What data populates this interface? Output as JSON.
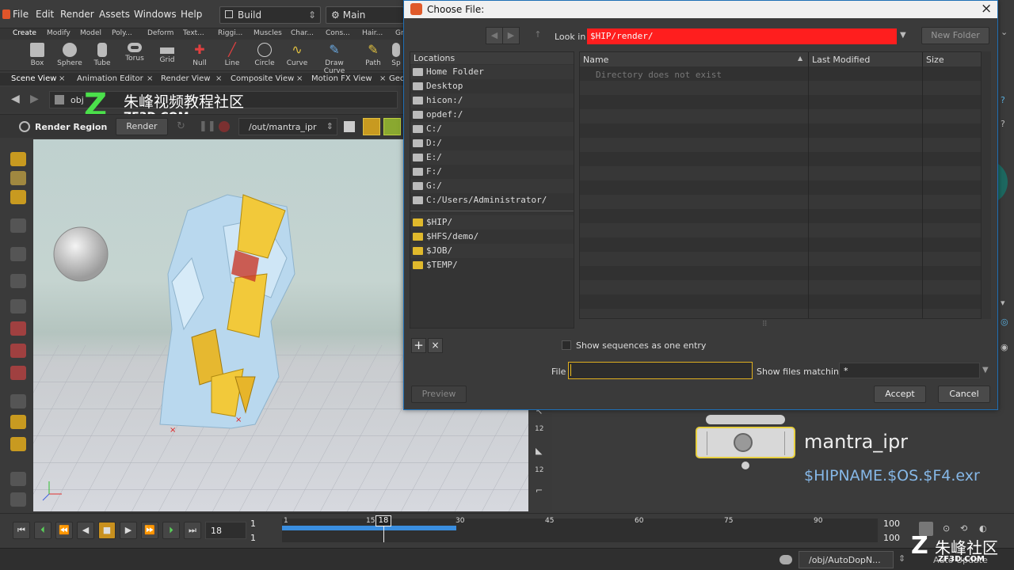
{
  "menubar": {
    "items": [
      "File",
      "Edit",
      "Render",
      "Assets",
      "Windows",
      "Help"
    ],
    "desktop_label": "Build",
    "context_label": "Main"
  },
  "shelf": {
    "tabs": [
      "Create",
      "Modify",
      "Model",
      "Poly...",
      "Deform",
      "Text...",
      "Riggi...",
      "Muscles",
      "Char...",
      "Cons...",
      "Hair...",
      "Gr"
    ],
    "tools": [
      "Box",
      "Sphere",
      "Tube",
      "Torus",
      "Grid",
      "Null",
      "Line",
      "Circle",
      "Curve",
      "Draw Curve",
      "Path",
      "Sp"
    ]
  },
  "panetabs": [
    "Scene View",
    "Animation Editor",
    "Render View",
    "Composite View",
    "Motion FX View",
    "Geo"
  ],
  "pathbar": {
    "path": "obj"
  },
  "watermark": {
    "text": "朱峰视频教程社区",
    "sub": "ZE3D.COM",
    "corner_text": "朱峰社区",
    "corner_sub": "ZF3D.COM"
  },
  "renderbar": {
    "region_label": "Render Region",
    "render_label": "Render",
    "rop_path": "/out/mantra_ipr"
  },
  "dialog": {
    "title": "Choose File:",
    "look_in_label": "Look in",
    "look_in_value": "$HIP/render/",
    "new_folder_label": "New Folder",
    "locations_header": "Locations",
    "locations": [
      {
        "label": "Home Folder",
        "icon": "home-icon"
      },
      {
        "label": "Desktop",
        "icon": "desktop-icon"
      },
      {
        "label": "hicon:/",
        "icon": "drive-icon"
      },
      {
        "label": "opdef:/",
        "icon": "drive-icon"
      },
      {
        "label": "C:/",
        "icon": "drive-icon"
      },
      {
        "label": "D:/",
        "icon": "drive-icon"
      },
      {
        "label": "E:/",
        "icon": "drive-icon"
      },
      {
        "label": "F:/",
        "icon": "drive-icon"
      },
      {
        "label": "G:/",
        "icon": "drive-icon"
      },
      {
        "label": "C:/Users/Administrator/",
        "icon": "drive-icon"
      }
    ],
    "bookmarks": [
      "$HIP/",
      "$HFS/demo/",
      "$JOB/",
      "$TEMP/"
    ],
    "columns": [
      "Name",
      "Last Modified",
      "Size"
    ],
    "empty_message": "Directory does not exist",
    "show_sequences_label": "Show sequences as one entry",
    "file_label": "File",
    "file_value": "",
    "show_files_matching_label": "Show files matching",
    "show_files_matching_value": "*",
    "preview_label": "Preview",
    "accept_label": "Accept",
    "cancel_label": "Cancel"
  },
  "network": {
    "node_name": "mantra_ipr",
    "node_output": "$HIPNAME.$OS.$F4.exr"
  },
  "timeline": {
    "current_frame": "18",
    "start_frame": "1",
    "start_frame_2": "1",
    "end_frame": "100",
    "end_frame_2": "100",
    "ticks": [
      "1",
      "15",
      "30",
      "45",
      "60",
      "75",
      "90"
    ],
    "marker": "18"
  },
  "status": {
    "path": "/obj/AutoDopN...",
    "update_mode": "Auto Update"
  },
  "colors": {
    "lookin_bg": "#ff1e1e",
    "node_outline": "#e8d040",
    "output_text": "#86b8e8",
    "timeline_cache": "#3a8ee0"
  }
}
